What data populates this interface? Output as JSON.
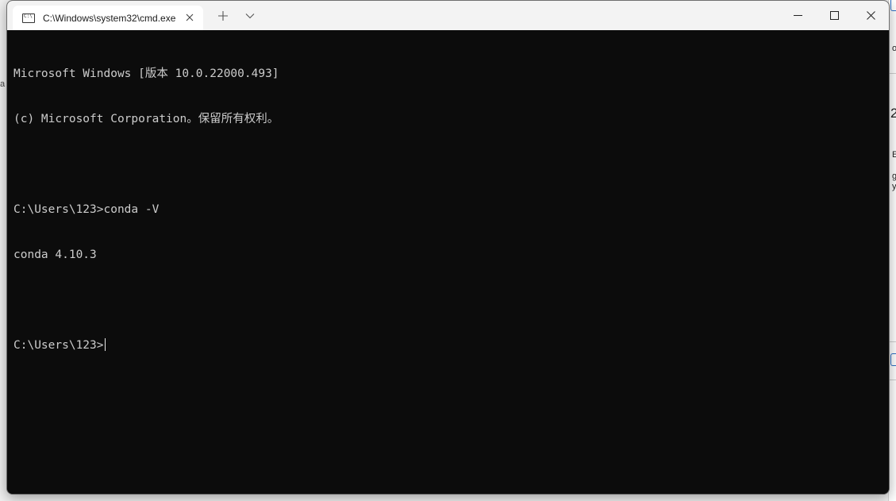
{
  "window": {
    "tab_title": "C:\\Windows\\system32\\cmd.exe"
  },
  "icons": {
    "tab": "terminal-icon",
    "close_tab": "close-icon",
    "new_tab": "plus-icon",
    "dropdown": "chevron-down-icon",
    "minimize": "minimize-icon",
    "maximize": "maximize-icon",
    "close_window": "close-icon"
  },
  "console": {
    "lines": [
      "Microsoft Windows [版本 10.0.22000.493]",
      "(c) Microsoft Corporation。保留所有权利。",
      "",
      "C:\\Users\\123>conda -V",
      "conda 4.10.3",
      "",
      "C:\\Users\\123>"
    ]
  },
  "background_fragments": {
    "left": "a",
    "right": [
      "o",
      "2",
      "E",
      "g",
      "y"
    ]
  },
  "colors": {
    "console_bg": "#0c0c0c",
    "console_text": "#cccccc",
    "titlebar_bg": "#f3f3f3"
  }
}
